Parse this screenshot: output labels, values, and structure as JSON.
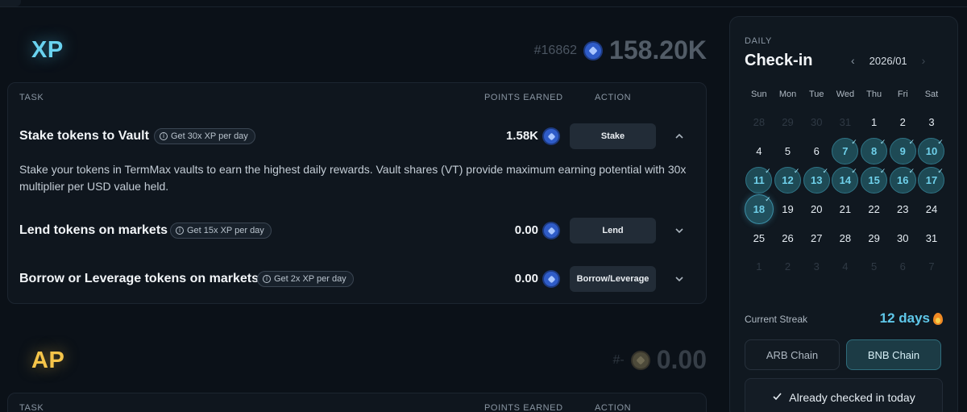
{
  "xp": {
    "title": "XP",
    "rank": "#16862",
    "total": "158.20K",
    "headers": {
      "task": "TASK",
      "points": "POINTS EARNED",
      "action": "ACTION"
    },
    "tasks": [
      {
        "title": "Stake tokens to Vault",
        "tag": "Get 30x XP per day",
        "points": "1.58K",
        "action": "Stake",
        "expanded": true,
        "description": "Stake your tokens in TermMax vaults to earn the highest daily rewards. Vault shares (VT) provide maximum earning potential with 30x multiplier per USD value held."
      },
      {
        "title": "Lend tokens on markets",
        "tag": "Get 15x XP per day",
        "points": "0.00",
        "action": "Lend",
        "expanded": false
      },
      {
        "title": "Borrow or Leverage tokens on markets",
        "tag": "Get 2x XP per day",
        "points": "0.00",
        "action": "Borrow/Leverage",
        "expanded": false
      }
    ]
  },
  "ap": {
    "title": "AP",
    "rank": "#-",
    "total": "0.00",
    "headers": {
      "task": "TASK",
      "points": "POINTS EARNED",
      "action": "ACTION"
    }
  },
  "checkin": {
    "label": "DAILY",
    "title": "Check-in",
    "month": "2026/01",
    "weekdays": [
      "Sun",
      "Mon",
      "Tue",
      "Wed",
      "Thu",
      "Fri",
      "Sat"
    ],
    "days": [
      {
        "d": "28",
        "m": true
      },
      {
        "d": "29",
        "m": true
      },
      {
        "d": "30",
        "m": true
      },
      {
        "d": "31",
        "m": true
      },
      {
        "d": "1"
      },
      {
        "d": "2"
      },
      {
        "d": "3"
      },
      {
        "d": "4"
      },
      {
        "d": "5"
      },
      {
        "d": "6"
      },
      {
        "d": "7",
        "c": true
      },
      {
        "d": "8",
        "c": true
      },
      {
        "d": "9",
        "c": true
      },
      {
        "d": "10",
        "c": true
      },
      {
        "d": "11",
        "c": true
      },
      {
        "d": "12",
        "c": true
      },
      {
        "d": "13",
        "c": true
      },
      {
        "d": "14",
        "c": true
      },
      {
        "d": "15",
        "c": true
      },
      {
        "d": "16",
        "c": true
      },
      {
        "d": "17",
        "c": true
      },
      {
        "d": "18",
        "c": true,
        "t": true
      },
      {
        "d": "19"
      },
      {
        "d": "20"
      },
      {
        "d": "21"
      },
      {
        "d": "22"
      },
      {
        "d": "23"
      },
      {
        "d": "24"
      },
      {
        "d": "25"
      },
      {
        "d": "26"
      },
      {
        "d": "27"
      },
      {
        "d": "28"
      },
      {
        "d": "29"
      },
      {
        "d": "30"
      },
      {
        "d": "31"
      },
      {
        "d": "1",
        "m": true
      },
      {
        "d": "2",
        "m": true
      },
      {
        "d": "3",
        "m": true
      },
      {
        "d": "4",
        "m": true
      },
      {
        "d": "5",
        "m": true
      },
      {
        "d": "6",
        "m": true
      },
      {
        "d": "7",
        "m": true
      }
    ],
    "streak_label": "Current Streak",
    "streak_value": "12 days",
    "chains": [
      "ARB Chain",
      "BNB Chain"
    ],
    "selected_chain": "BNB Chain",
    "status": "Already checked in today"
  },
  "colors": {
    "xp_accent": "#6ad3f0",
    "ap_accent": "#f6c54a",
    "checked_day": "#1e4a55",
    "streak": "#5fc8ea"
  },
  "icons": [
    "xp-coin-icon",
    "ap-coin-icon",
    "info-icon",
    "chevron-up-icon",
    "chevron-down-icon",
    "checkmark-icon",
    "flame-icon"
  ]
}
